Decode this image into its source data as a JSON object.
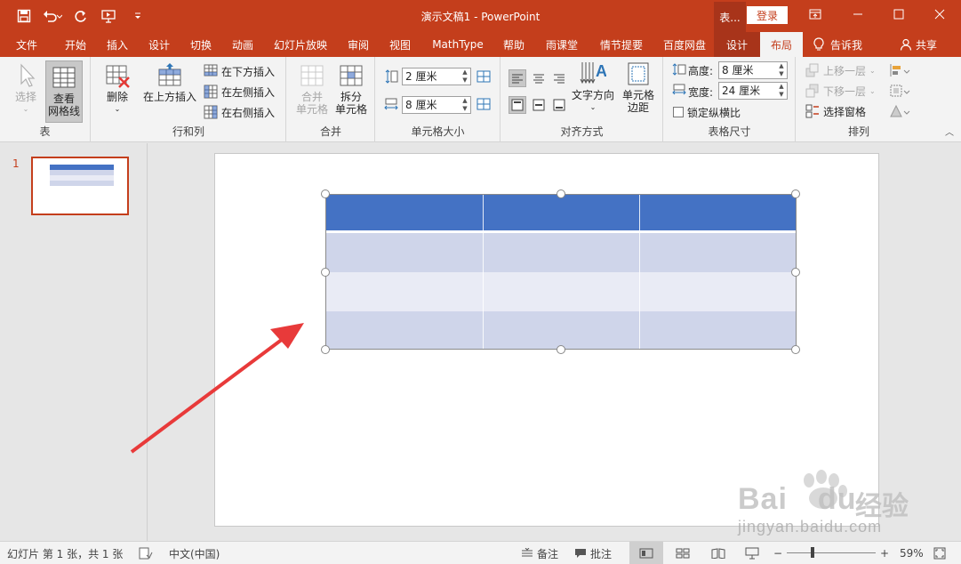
{
  "app": {
    "doc_title": "演示文稿1  -  PowerPoint",
    "context_tab_header": "表...",
    "login_label": "登录"
  },
  "qat": {
    "icons": [
      "save-icon",
      "undo-icon",
      "redo-icon",
      "present-from-start-icon",
      "customize-qat-icon"
    ]
  },
  "tabs": [
    {
      "label": "文件"
    },
    {
      "label": "开始"
    },
    {
      "label": "插入"
    },
    {
      "label": "设计"
    },
    {
      "label": "切换"
    },
    {
      "label": "动画"
    },
    {
      "label": "幻灯片放映"
    },
    {
      "label": "审阅"
    },
    {
      "label": "视图"
    },
    {
      "label": "MathType"
    },
    {
      "label": "帮助"
    },
    {
      "label": "雨课堂"
    },
    {
      "label": "情节提要"
    },
    {
      "label": "百度网盘"
    },
    {
      "label": "设计"
    },
    {
      "label": "布局"
    }
  ],
  "tell_me": "告诉我",
  "share": "共享",
  "ribbon": {
    "table_group": {
      "select": "选择",
      "gridlines_1": "查看",
      "gridlines_2": "网格线",
      "label": "表"
    },
    "rows_cols_group": {
      "delete": "删除",
      "insert_above": "在上方插入",
      "insert_below": "在下方插入",
      "insert_left": "在左侧插入",
      "insert_right": "在右侧插入",
      "label": "行和列"
    },
    "merge_group": {
      "merge_1": "合并",
      "merge_2": "单元格",
      "split_1": "拆分",
      "split_2": "单元格",
      "label": "合并"
    },
    "cell_size_group": {
      "height": "2 厘米",
      "width": "8 厘米",
      "label": "单元格大小"
    },
    "alignment_group": {
      "text_direction": "文字方向",
      "cell_margins_1": "单元格",
      "cell_margins_2": "边距",
      "label": "对齐方式"
    },
    "table_size_group": {
      "height_label": "高度:",
      "height_value": "8 厘米",
      "width_label": "宽度:",
      "width_value": "24 厘米",
      "lock_ratio": "锁定纵横比",
      "label": "表格尺寸"
    },
    "arrange_group": {
      "bring_forward": "上移一层",
      "send_backward": "下移一层",
      "selection_pane": "选择窗格",
      "label": "排列"
    }
  },
  "thumbnails": [
    {
      "number": "1"
    }
  ],
  "statusbar": {
    "slide_info": "幻灯片 第 1 张，共 1 张",
    "language": "中文(中国)",
    "notes": "备注",
    "comments": "批注",
    "zoom_minus": "−",
    "zoom_plus": "+",
    "zoom": "59%"
  },
  "colors": {
    "accent": "#c43e1c",
    "table_header": "#4472c4",
    "table_band_dark": "#cfd5ea",
    "table_band_light": "#e9ebf5",
    "arrow": "#e83a3a"
  },
  "watermark": {
    "brand": "Bai",
    "brand2": "du",
    "cn": "经验",
    "url": "jingyan.baidu.com"
  }
}
